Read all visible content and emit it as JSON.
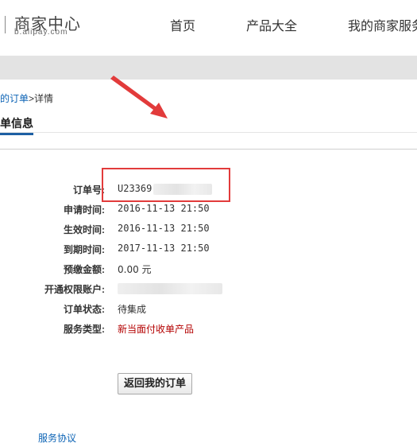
{
  "header": {
    "logo_title": "商家中心",
    "logo_sub": "b.alipay.com",
    "nav": [
      "首页",
      "产品大全",
      "我的商家服务"
    ]
  },
  "breadcrumb": {
    "link": "我的订单",
    "sep": ">",
    "current": "详情"
  },
  "section_title": "订单信息",
  "order": {
    "rows": [
      {
        "label": "订单号:",
        "value": "U23369"
      },
      {
        "label": "申请时间:",
        "value": "2016-11-13 21:50"
      },
      {
        "label": "生效时间:",
        "value": "2016-11-13 21:50"
      },
      {
        "label": "到期时间:",
        "value": "2017-11-13 21:50"
      },
      {
        "label": "预缴金额:",
        "value": "0.00 元"
      },
      {
        "label": "开通权限账户:",
        "value": ""
      },
      {
        "label": "订单状态:",
        "value": "待集成"
      },
      {
        "label": "服务类型:",
        "value": "新当面付收单产品"
      }
    ]
  },
  "back_button": "返回我的订单",
  "footer_link": "服务协议",
  "colors": {
    "link": "#0c63b5",
    "highlight_box": "#e23b3b",
    "service_type": "#b40000",
    "title_underline": "#1d5fa3"
  }
}
